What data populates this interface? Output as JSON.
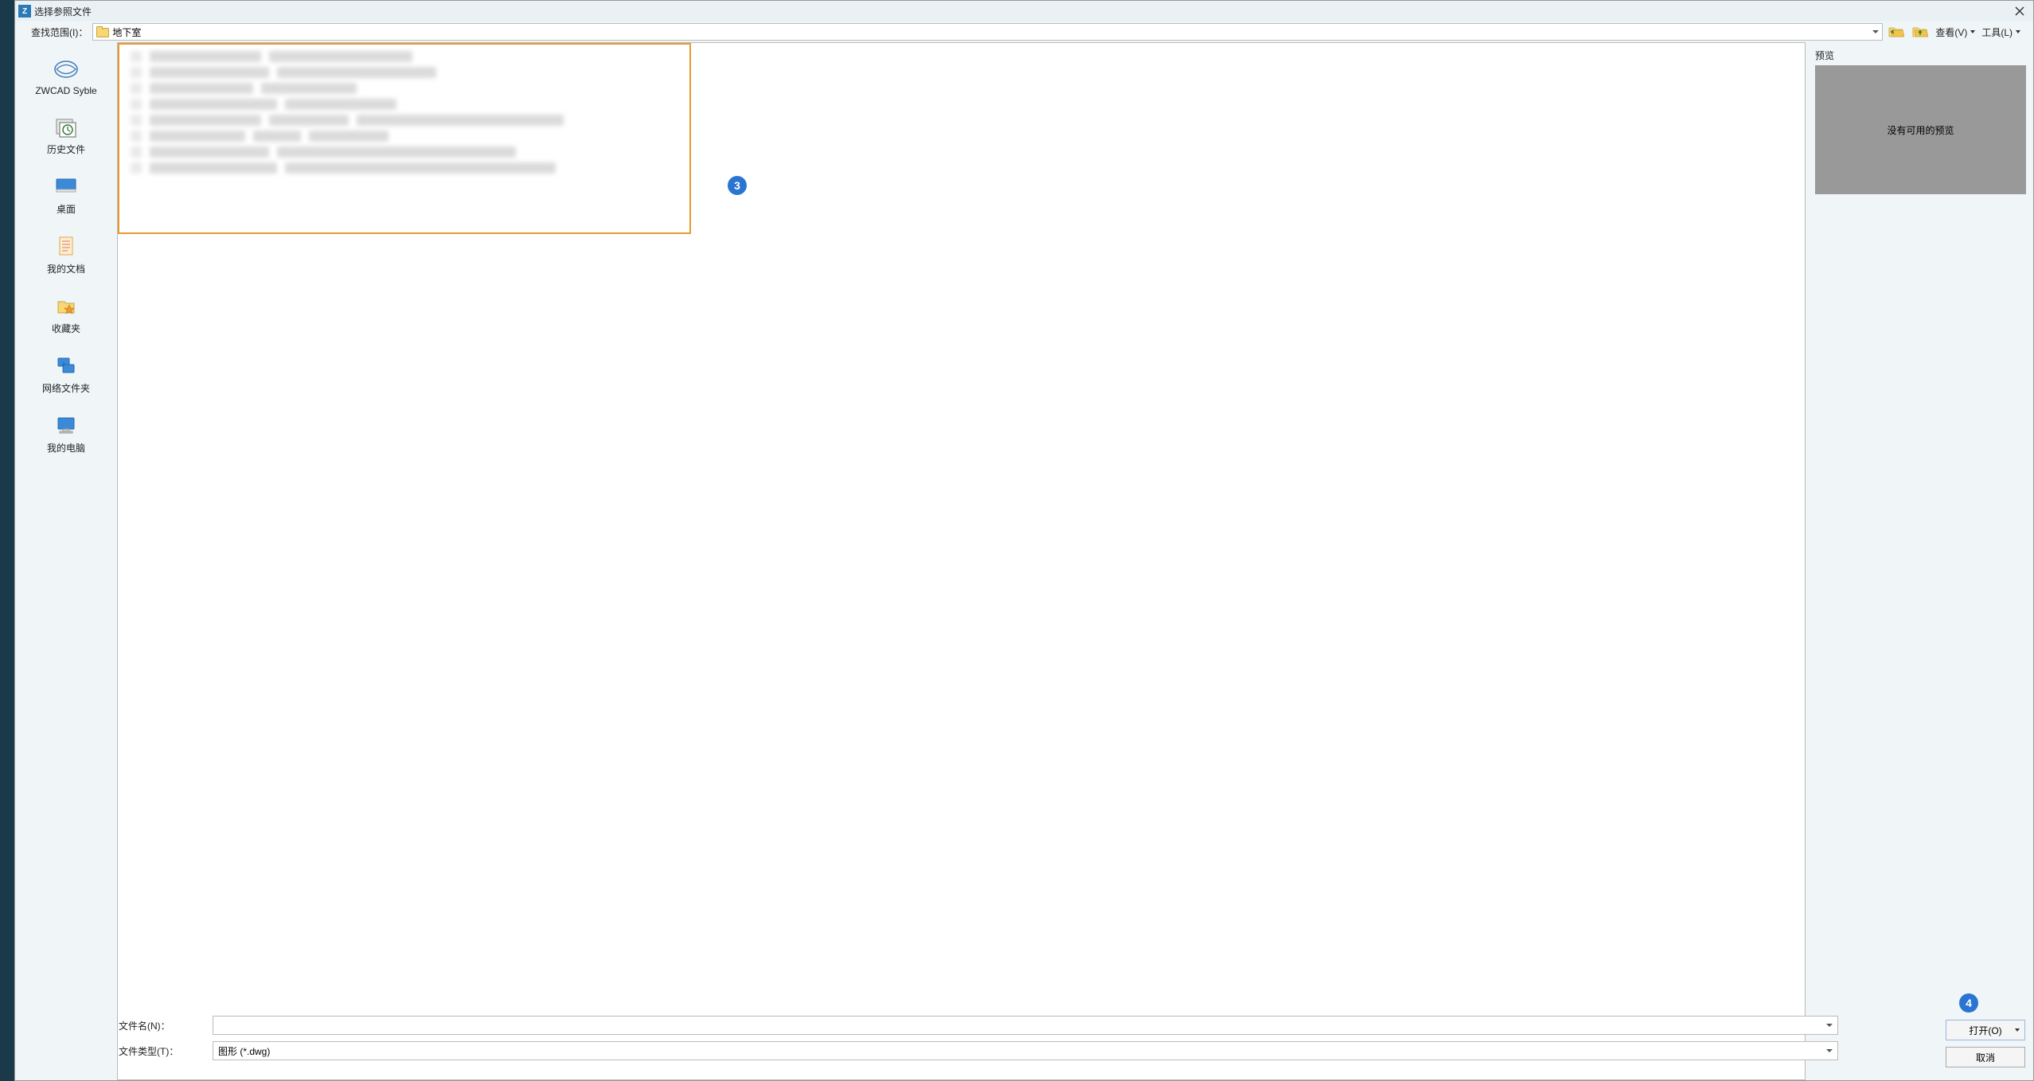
{
  "dialog": {
    "title": "选择参照文件",
    "lookup_label": "查找范围(I)：",
    "lookup_value": "地下室",
    "toolbar": {
      "view_label": "查看(V)",
      "tools_label": "工具(L)"
    }
  },
  "sidebar": {
    "items": [
      {
        "label": "ZWCAD Syble",
        "icon": "zwcad"
      },
      {
        "label": "历史文件",
        "icon": "history"
      },
      {
        "label": "桌面",
        "icon": "desktop"
      },
      {
        "label": "我的文档",
        "icon": "documents"
      },
      {
        "label": "收藏夹",
        "icon": "favorites"
      },
      {
        "label": "网络文件夹",
        "icon": "network"
      },
      {
        "label": "我的电脑",
        "icon": "computer"
      }
    ]
  },
  "preview": {
    "label": "预览",
    "empty_text": "没有可用的预览"
  },
  "bottom": {
    "filename_label": "文件名(N)：",
    "filename_value": "",
    "filetype_label": "文件类型(T)：",
    "filetype_value": "图形 (*.dwg)",
    "open_label": "打开(O)",
    "cancel_label": "取消"
  },
  "callouts": {
    "c3": "3",
    "c4": "4"
  }
}
